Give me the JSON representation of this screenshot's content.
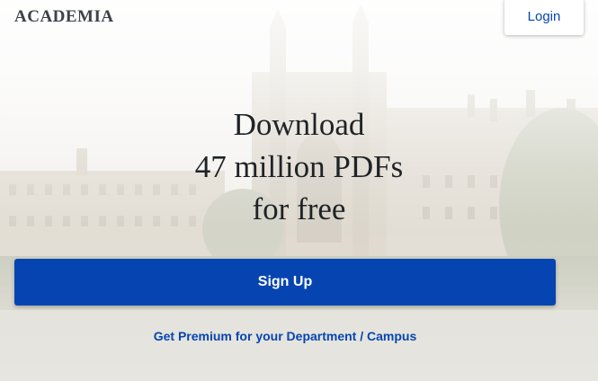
{
  "header": {
    "logo": "ACADEMIA",
    "login_label": "Login"
  },
  "hero": {
    "line1": "Download",
    "line2": "47 million PDFs",
    "line3": "for free"
  },
  "actions": {
    "signup_label": "Sign Up",
    "premium_label": "Get Premium for your Department / Campus"
  },
  "colors": {
    "brand_blue": "#0645b1",
    "logo_gray": "#3c4249",
    "headline": "#1f2327"
  }
}
